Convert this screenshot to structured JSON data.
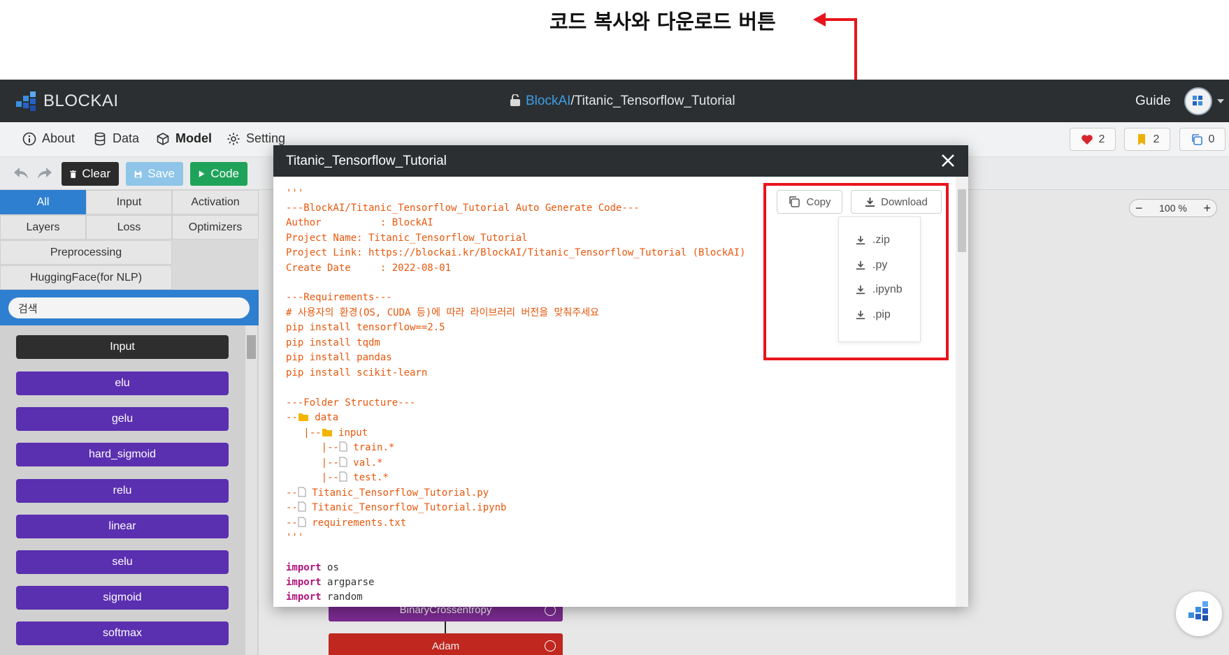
{
  "annotation": {
    "title": "코드 복사와 다운로드 버튼",
    "color": "#e8141c"
  },
  "header": {
    "logo": "BLOCKAI",
    "project_owner": "BlockAI",
    "project_sep": "/",
    "project_name": "Titanic_Tensorflow_Tutorial",
    "guide": "Guide"
  },
  "nav": {
    "items": [
      {
        "label": "About",
        "icon": "info-icon"
      },
      {
        "label": "Data",
        "icon": "database-icon"
      },
      {
        "label": "Model",
        "icon": "cube-icon",
        "active": true
      },
      {
        "label": "Setting",
        "icon": "gear-icon"
      }
    ]
  },
  "stats": {
    "likes": "2",
    "bookmarks": "2",
    "copies": "0"
  },
  "toolbar": {
    "clear": "Clear",
    "save": "Save",
    "code": "Code"
  },
  "sidebar": {
    "categories": [
      "All",
      "Input",
      "Activation",
      "Layers",
      "Loss",
      "Optimizers",
      "Preprocessing",
      "HuggingFace(for NLP)"
    ],
    "search_value": "검색",
    "blocks": [
      "Input",
      "elu",
      "gelu",
      "hard_sigmoid",
      "relu",
      "linear",
      "selu",
      "sigmoid",
      "softmax"
    ]
  },
  "canvas": {
    "zoom": "100 %",
    "zoom_minus": "−",
    "zoom_plus": "+",
    "nodes": [
      "BinaryCrossentropy",
      "Adam"
    ]
  },
  "modal": {
    "title": "Titanic_Tensorflow_Tutorial",
    "copy_label": "Copy",
    "download_label": "Download",
    "download_options": [
      ".zip",
      ".py",
      ".ipynb",
      ".pip"
    ],
    "code": {
      "l01": "'''",
      "l02": "---BlockAI/Titanic_Tensorflow_Tutorial Auto Generate Code---",
      "l03": "Author          : BlockAI",
      "l04": "Project Name: Titanic_Tensorflow_Tutorial",
      "l05": "Project Link: https://blockai.kr/BlockAI/Titanic_Tensorflow_Tutorial (BlockAI)",
      "l06": "Create Date     : 2022-08-01",
      "l08": "---Requirements---",
      "l09": "# 사용자의 환경(OS, CUDA 등)에 따라 라이브러리 버전을 맞춰주세요",
      "l10": "pip install tensorflow==2.5",
      "l11": "pip install tqdm",
      "l12": "pip install pandas",
      "l13": "pip install scikit-learn",
      "l15": "---Folder Structure---",
      "l16_prefix": "--",
      "l16": "data",
      "l17_prefix": "   |--",
      "l17": "input",
      "l18_prefix": "      |--",
      "l18": "train.*",
      "l19_prefix": "      |--",
      "l19": "val.*",
      "l20_prefix": "      |--",
      "l20": "test.*",
      "l21_prefix": "--",
      "l21": "Titanic_Tensorflow_Tutorial.py",
      "l22_prefix": "--",
      "l22": "Titanic_Tensorflow_Tutorial.ipynb",
      "l23_prefix": "--",
      "l23": "requirements.txt",
      "l24": "'''",
      "import_kw": "import",
      "i1": "os",
      "i2": "argparse",
      "i3": "random"
    }
  }
}
